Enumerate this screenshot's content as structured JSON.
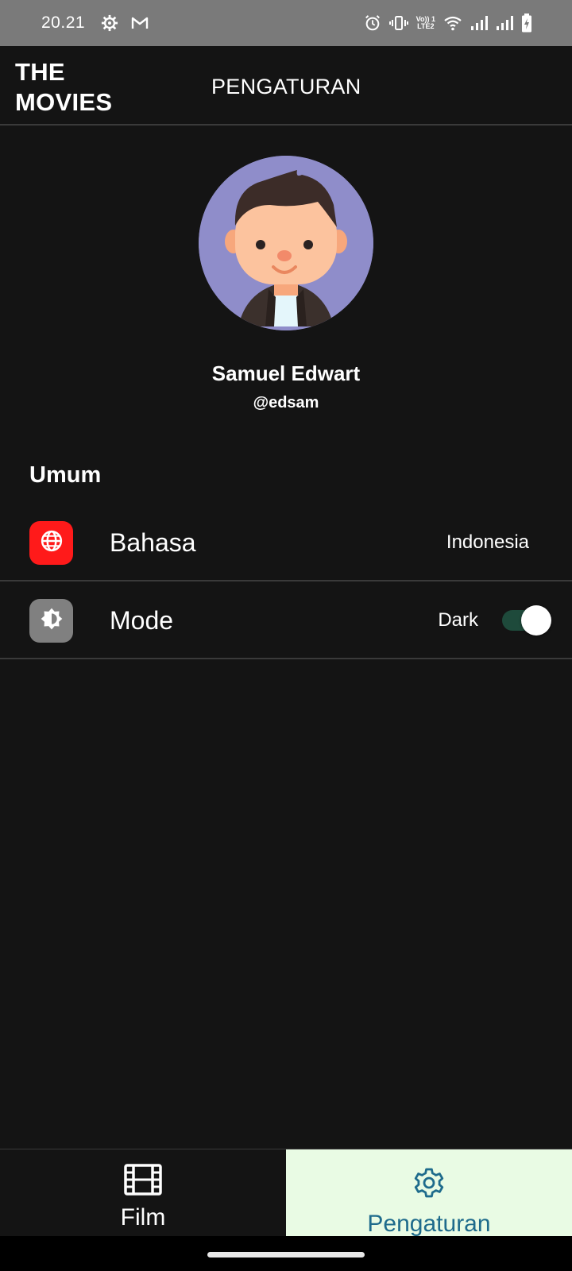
{
  "status_bar": {
    "time": "20.21",
    "lte_label_top": "Vo)) 1",
    "lte_label_bottom": "LTE2"
  },
  "header": {
    "brand_line1": "THE",
    "brand_line2": "MOVIES",
    "title": "PENGATURAN"
  },
  "profile": {
    "name": "Samuel Edwart",
    "handle": "@edsam"
  },
  "section": {
    "title": "Umum"
  },
  "settings": {
    "language": {
      "label": "Bahasa",
      "value": "Indonesia",
      "icon": "globe-icon",
      "icon_color": "#ff1a1a"
    },
    "mode": {
      "label": "Mode",
      "value": "Dark",
      "icon": "brightness-icon",
      "icon_color": "#808080",
      "toggle_on": true
    }
  },
  "bottom_nav": {
    "film_label": "Film",
    "settings_label": "Pengaturan",
    "active": "settings",
    "active_bg": "#e9fbe4",
    "active_color": "#1e6b8c"
  }
}
